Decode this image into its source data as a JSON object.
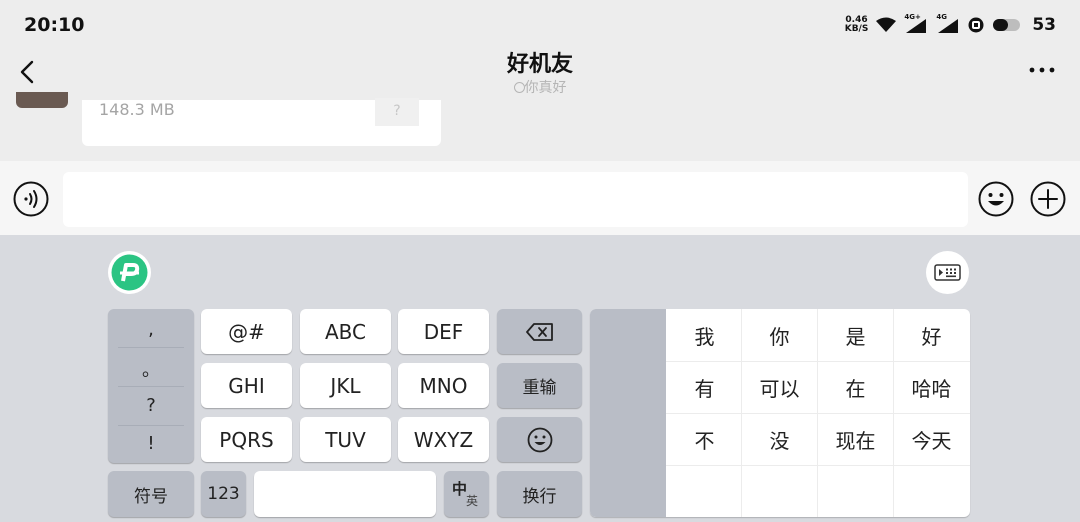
{
  "status_bar": {
    "time": "20:10",
    "net_speed_value": "0.46",
    "net_speed_unit": "KB/S",
    "signal1_label": "4G+",
    "signal2_label": "4G",
    "battery": "53"
  },
  "header": {
    "title": "好机友",
    "subtitle": "你真好"
  },
  "chat": {
    "file_size": "148.3 MB",
    "file_unknown": "?"
  },
  "keyboard": {
    "punct": [
      ",",
      "。",
      "?",
      "!"
    ],
    "keys_row1": [
      "@#",
      "ABC",
      "DEF"
    ],
    "keys_row2": [
      "GHI",
      "JKL",
      "MNO"
    ],
    "retype": "重输",
    "keys_row3": [
      "PQRS",
      "TUV",
      "WXYZ"
    ],
    "symbols": "符号",
    "numbers": "123",
    "lang_top": "中",
    "lang_bottom": "英",
    "enter": "换行",
    "candidates": [
      [
        "我",
        "你",
        "是",
        "好"
      ],
      [
        "有",
        "可以",
        "在",
        "哈哈"
      ],
      [
        "不",
        "没",
        "现在",
        "今天"
      ]
    ]
  },
  "colors": {
    "keyboard_bg": "#d8dadf",
    "function_key": "#b9bdc6",
    "brand_green": "#2bc483"
  }
}
